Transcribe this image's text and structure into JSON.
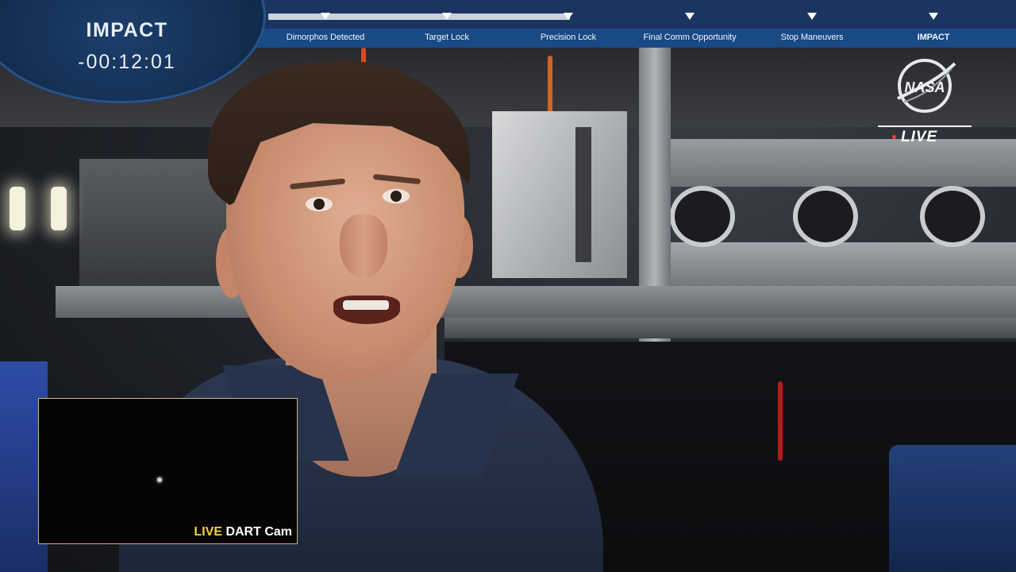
{
  "countdown": {
    "title": "IMPACT",
    "time": "-00:12:01"
  },
  "timeline": {
    "progress_fraction": 0.5,
    "milestones": [
      {
        "label": "Dimorphos Detected"
      },
      {
        "label": "Target Lock"
      },
      {
        "label": "Precision Lock"
      },
      {
        "label": "Final Comm Opportunity"
      },
      {
        "label": "Stop Maneuvers"
      },
      {
        "label": "IMPACT"
      }
    ]
  },
  "broadcast": {
    "logo": "NASA",
    "live_label": "LIVE"
  },
  "pip": {
    "live_label": "LIVE",
    "camera_label": "DART Cam"
  },
  "colors": {
    "banner_dark": "#1c3560",
    "banner_blue": "#1a4a86",
    "live_yellow": "#f4d13b"
  }
}
